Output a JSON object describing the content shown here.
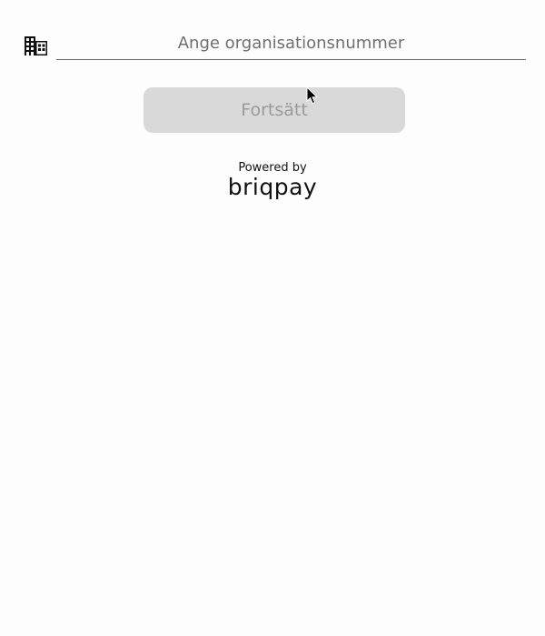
{
  "org_field": {
    "icon": "building-icon",
    "value": "",
    "placeholder": "Ange organisationsnummer"
  },
  "continue_button": {
    "label": "Fortsätt"
  },
  "footer": {
    "powered_by": "Powered by",
    "brand": "briqpay"
  },
  "colors": {
    "background": "#fefdfe",
    "button_bg_disabled": "#dad9da",
    "button_text_disabled": "#9a9a9a",
    "input_underline": "#6a6a6a",
    "text_dark": "#111111"
  }
}
